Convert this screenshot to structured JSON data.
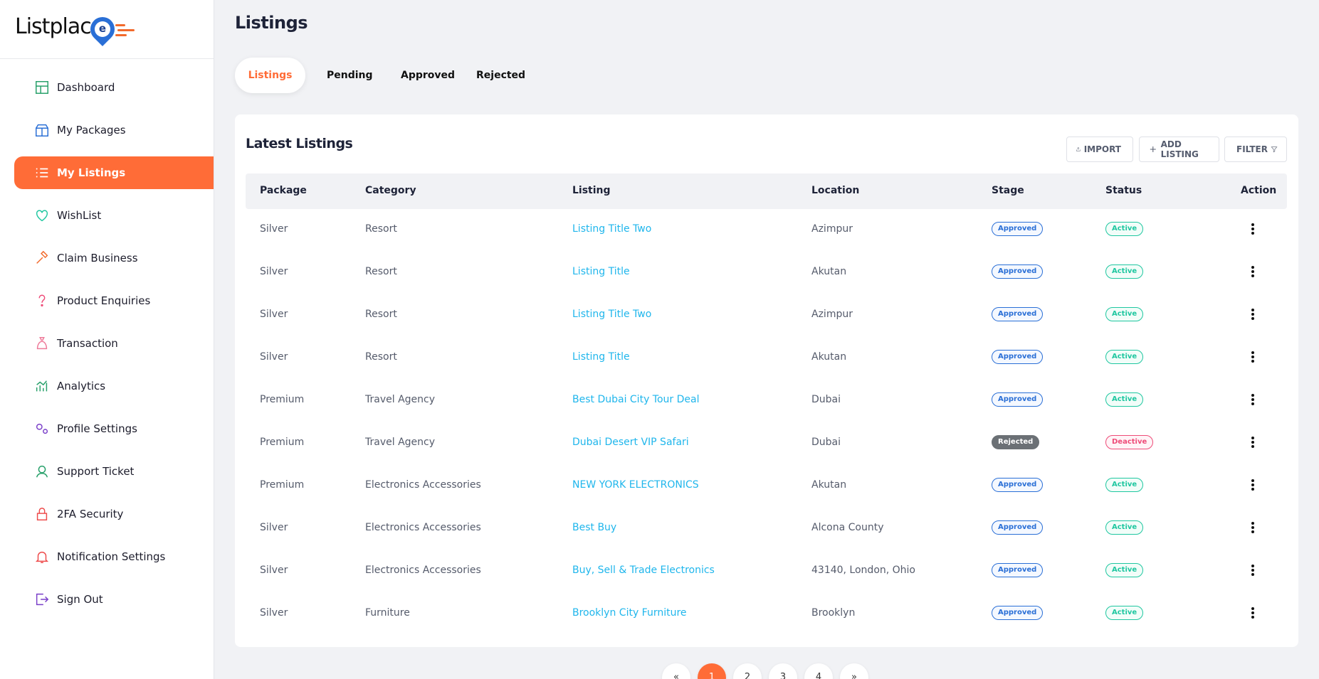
{
  "brand": {
    "logo_text": "Listplac",
    "logo_letter": "e",
    "accent": "#ff6c37"
  },
  "sidebar": {
    "items": [
      {
        "label": "Dashboard",
        "icon": "dashboard-icon",
        "active": false
      },
      {
        "label": "My Packages",
        "icon": "package-icon",
        "active": false
      },
      {
        "label": "My Listings",
        "icon": "list-icon",
        "active": true
      },
      {
        "label": "WishList",
        "icon": "heart-icon",
        "active": false
      },
      {
        "label": "Claim Business",
        "icon": "hammer-icon",
        "active": false
      },
      {
        "label": "Product Enquiries",
        "icon": "question-icon",
        "active": false
      },
      {
        "label": "Transaction",
        "icon": "money-bag-icon",
        "active": false
      },
      {
        "label": "Analytics",
        "icon": "analytics-icon",
        "active": false
      },
      {
        "label": "Profile Settings",
        "icon": "gears-icon",
        "active": false
      },
      {
        "label": "Support Ticket",
        "icon": "support-icon",
        "active": false
      },
      {
        "label": "2FA Security",
        "icon": "lock-icon",
        "active": false
      },
      {
        "label": "Notification Settings",
        "icon": "bell-icon",
        "active": false
      },
      {
        "label": "Sign Out",
        "icon": "sign-out-icon",
        "active": false
      }
    ]
  },
  "header": {
    "title": "Listings"
  },
  "tabs": [
    {
      "label": "Listings",
      "active": true
    },
    {
      "label": "Pending",
      "active": false
    },
    {
      "label": "Approved",
      "active": false
    },
    {
      "label": "Rejected",
      "active": false
    }
  ],
  "card": {
    "title": "Latest Listings",
    "buttons": {
      "import": "IMPORT",
      "add": "ADD LISTING",
      "filter": "FILTER"
    }
  },
  "table": {
    "columns": [
      "Package",
      "Category",
      "Listing",
      "Location",
      "Stage",
      "Status",
      "Action"
    ],
    "rows": [
      {
        "package": "Silver",
        "category": "Resort",
        "listing": "Listing Title Two",
        "location": "Azimpur",
        "stage": "Approved",
        "status": "Active"
      },
      {
        "package": "Silver",
        "category": "Resort",
        "listing": "Listing Title",
        "location": "Akutan",
        "stage": "Approved",
        "status": "Active"
      },
      {
        "package": "Silver",
        "category": "Resort",
        "listing": "Listing Title Two",
        "location": "Azimpur",
        "stage": "Approved",
        "status": "Active"
      },
      {
        "package": "Silver",
        "category": "Resort",
        "listing": "Listing Title",
        "location": "Akutan",
        "stage": "Approved",
        "status": "Active"
      },
      {
        "package": "Premium",
        "category": "Travel Agency",
        "listing": "Best Dubai City Tour Deal",
        "location": "Dubai",
        "stage": "Approved",
        "status": "Active"
      },
      {
        "package": "Premium",
        "category": "Travel Agency",
        "listing": "Dubai Desert VIP Safari",
        "location": "Dubai",
        "stage": "Rejected",
        "status": "Deactive"
      },
      {
        "package": "Premium",
        "category": "Electronics Accessories",
        "listing": "NEW YORK ELECTRONICS",
        "location": "Akutan",
        "stage": "Approved",
        "status": "Active"
      },
      {
        "package": "Silver",
        "category": "Electronics Accessories",
        "listing": "Best Buy",
        "location": "Alcona County",
        "stage": "Approved",
        "status": "Active"
      },
      {
        "package": "Silver",
        "category": "Electronics Accessories",
        "listing": "Buy, Sell & Trade Electronics",
        "location": "43140, London, Ohio",
        "stage": "Approved",
        "status": "Active"
      },
      {
        "package": "Silver",
        "category": "Furniture",
        "listing": "Brooklyn City Furniture",
        "location": "Brooklyn",
        "stage": "Approved",
        "status": "Active"
      }
    ]
  },
  "pagination": {
    "prev": "«",
    "pages": [
      "1",
      "2",
      "3",
      "4"
    ],
    "next": "»",
    "current": "1"
  }
}
